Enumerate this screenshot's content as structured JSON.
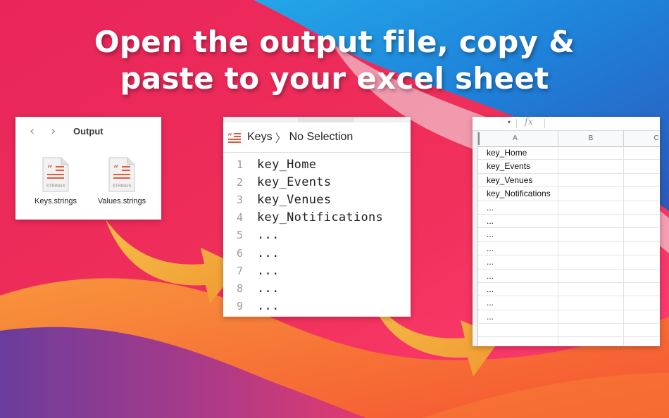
{
  "headline": {
    "line1": "Open the output file, copy &",
    "line2": "paste to your excel sheet"
  },
  "colors": {
    "background_top_left": "#e9255a",
    "background_blue": "#1f7fd8",
    "background_orange": "#f5762a",
    "background_purple": "#6b3c9c",
    "arrow": "#f2a23a",
    "strings_icon_accent": "#e6573c"
  },
  "finder": {
    "back_icon": "chevron-left-icon",
    "forward_icon": "chevron-right-icon",
    "title": "Output",
    "files": [
      {
        "name": "Keys.strings",
        "icon_label": "STRINGS",
        "icon": "strings-file-icon"
      },
      {
        "name": "Values.strings",
        "icon_label": "STRINGS",
        "icon": "strings-file-icon"
      }
    ]
  },
  "editor": {
    "file_icon": "strings-document-icon",
    "breadcrumb_file": "Keys",
    "breadcrumb_sep": "〉",
    "breadcrumb_selection": "No Selection",
    "lines": [
      {
        "n": "1",
        "text": "key_Home"
      },
      {
        "n": "2",
        "text": "key_Events"
      },
      {
        "n": "3",
        "text": "key_Venues"
      },
      {
        "n": "4",
        "text": "key_Notifications"
      },
      {
        "n": "5",
        "text": "..."
      },
      {
        "n": "6",
        "text": "..."
      },
      {
        "n": "7",
        "text": "..."
      },
      {
        "n": "8",
        "text": "..."
      },
      {
        "n": "9",
        "text": "..."
      }
    ]
  },
  "sheet": {
    "name_box_dropdown": "▾",
    "fx_label": "fx",
    "columns": [
      "A",
      "B",
      "C"
    ],
    "column_a": [
      "key_Home",
      "key_Events",
      "key_Venues",
      "key_Notifications",
      "...",
      "...",
      "...",
      "...",
      "...",
      "...",
      "...",
      "...",
      "...",
      "",
      ""
    ]
  }
}
